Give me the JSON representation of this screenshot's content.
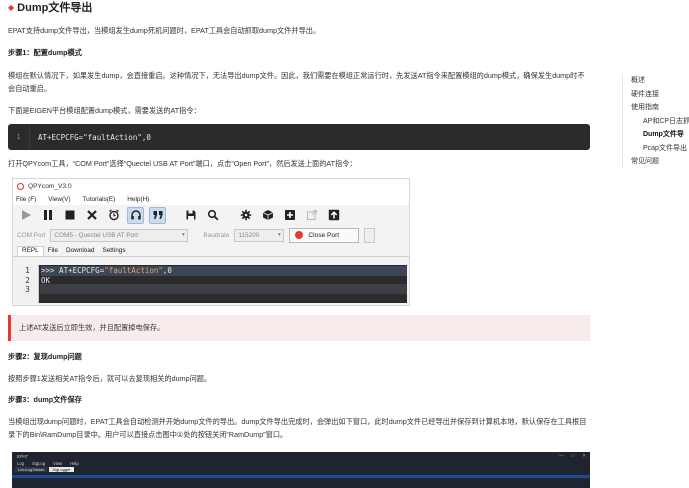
{
  "heading": "Dump文件导出",
  "intro": "EPAT支持dump文件导出，当模组发生dump死机问题时，EPAT工具会自动抓取dump文件并导出。",
  "step1_title": "步骤1：配置dump模式",
  "step1_desc": "模组在默认情况下，如果发生dump，会直接重启。这种情况下，无法导出dump文件。因此，我们需要在模组正常运行时，先发送AT指令来配置模组的dump模式，确保发生dump时不会自动重启。",
  "eigen_desc": "下面是EIGEN平台模组配置dump模式，需要发送的AT指令：",
  "code_block": {
    "line_number": "1",
    "code": "AT+ECPCFG=\"faultAction\",0"
  },
  "qpy_desc": "打开QPYcom工具，“COM Port”选择“Quectel USB AT Port”端口，点击“Open Port”，然后发送上面的AT指令：",
  "qpycom": {
    "title": "QPYcom_V3.0",
    "menu": [
      "File (F)",
      "View(V)",
      "Tutorials(E)",
      "Help(H)"
    ],
    "toolbar_icons": [
      "play-icon",
      "pause-icon",
      "stop-icon",
      "close-x-icon",
      "alarm-clock-icon",
      "headset-icon",
      "quote-icon",
      "save-icon",
      "search-icon",
      "gear-icon",
      "cube-icon",
      "add-square-icon",
      "export-icon",
      "upload-icon"
    ],
    "com_port_label": "COM Port",
    "com_port_value": "COM5 - Quectel USB AT Port",
    "baudrate_label": "Baudrate",
    "baudrate_value": "115200",
    "close_port_label": "Close Port",
    "tabs": [
      "REPL",
      "File",
      "Download",
      "Settings"
    ],
    "active_tab": "REPL",
    "terminal": {
      "line_numbers": [
        "1",
        "2",
        "3"
      ],
      "prompt": ">>> AT+ECPCFG=",
      "string_arg": "\"faultAction\"",
      "suffix": ",0",
      "response": "OK"
    }
  },
  "note": "上述AT发送后立即生效，并且配置掉电保存。",
  "step2_title": "步骤2：复现dump问题",
  "step2_desc": "按照步骤1发送相关AT指令后，就可以去复现相关的dump问题。",
  "step3_title": "步骤3：dump文件保存",
  "step3_desc": "当模组出现dump问题时，EPAT工具会自动检测并开始dump文件的导出。dump文件导出完成时，会弹出如下窗口，此时dump文件已经导出并保存到计算机本地，默认保存在工具根目录下的Bin\\RamDump目录中。用户可以直接点击图中①处的按钮关闭“RamDump”窗口。",
  "epat": {
    "title": "EPAT",
    "menu": [
      "Log",
      "SigLog",
      "View",
      "Help"
    ],
    "tabs": [
      "LinuLogViewer",
      "SigLogger"
    ],
    "active_tab": "SigLogger"
  },
  "toc": [
    {
      "label": "概述",
      "level": 1,
      "active": false
    },
    {
      "label": "硬件连接",
      "level": 1,
      "active": false
    },
    {
      "label": "使用指南",
      "level": 1,
      "active": false
    },
    {
      "label": "AP和CP日志抓",
      "level": 2,
      "active": false
    },
    {
      "label": "Dump文件导",
      "level": 2,
      "active": true
    },
    {
      "label": "Pcap文件导出",
      "level": 2,
      "active": false
    },
    {
      "label": "常见问题",
      "level": 1,
      "active": false
    }
  ],
  "colors": {
    "accent_red": "#e53935",
    "code_bg": "#2b2b2b",
    "note_bg": "#f8eceb"
  }
}
